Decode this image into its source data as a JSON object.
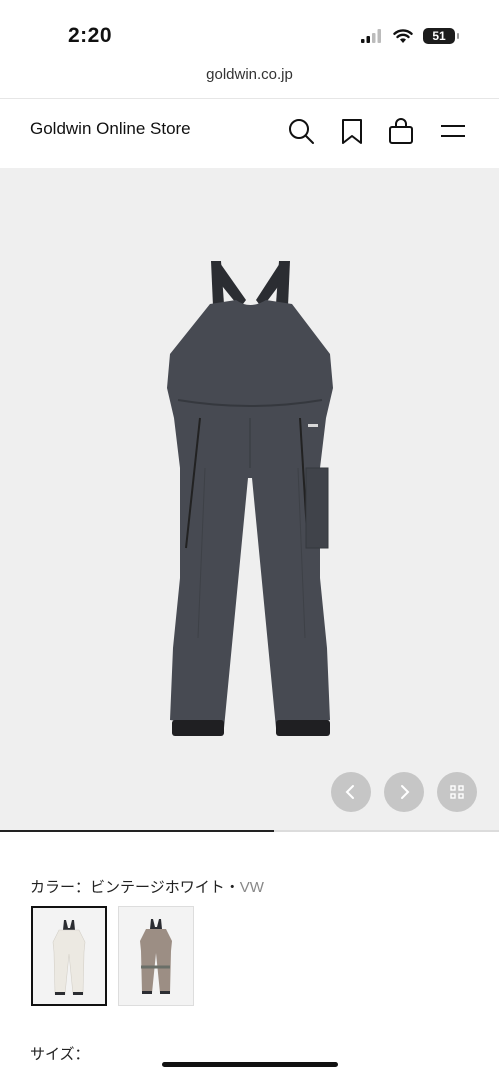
{
  "status_bar": {
    "time": "2:20",
    "battery": "51"
  },
  "browser": {
    "url": "goldwin.co.jp"
  },
  "header": {
    "brand": "Goldwin Online Store",
    "icons": [
      "search-icon",
      "bookmark-icon",
      "cart-icon",
      "menu-icon"
    ]
  },
  "gallery": {
    "progress": 0.55,
    "prev_icon": "chevron-left-icon",
    "next_icon": "chevron-right-icon",
    "grid_icon": "grid-icon"
  },
  "product": {
    "color_label": "カラー：ビンテージホワイト・",
    "color_code": "VW",
    "swatches": [
      {
        "name": "white",
        "color": "#ece9e2",
        "selected": true
      },
      {
        "name": "taupe",
        "color": "#9c8e84",
        "selected": false
      }
    ],
    "size_label": "サイズ："
  },
  "colors": {
    "pants": "#474a52",
    "strap": "#2b2d32",
    "cuff": "#1f1f22",
    "gallery_bg": "#efefef"
  }
}
